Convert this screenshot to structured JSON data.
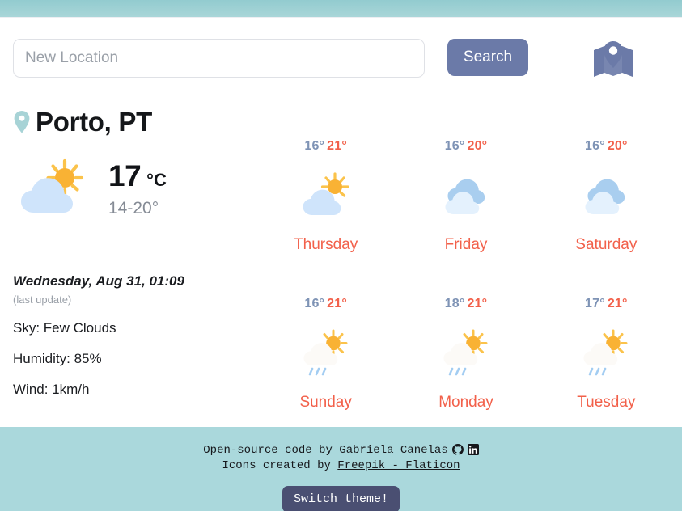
{
  "theme": {
    "teal_bar": "#a9d6d8",
    "footer_bg": "#aad8dc",
    "accent_button": "#6b7aa8",
    "theme_button": "#4a4f72",
    "max_temp_color": "#f2604a",
    "min_temp_color": "#7e93b5",
    "pin_color": "#a7d3d6"
  },
  "search": {
    "placeholder": "New Location",
    "value": "",
    "button_label": "Search",
    "map_icon": "map-pin-icon"
  },
  "current": {
    "location_pin_icon": "location-pin-icon",
    "city": "Porto, PT",
    "icon": "sun-behind-cloud-icon",
    "temperature": "17",
    "unit": "°C",
    "range": "14-20°"
  },
  "details": {
    "last_update_date": "Wednesday, Aug 31, 01:09",
    "last_update_note": "(last update)",
    "lines": [
      "Sky: Few Clouds",
      "Humidity: 85%",
      "Wind: 1km/h"
    ]
  },
  "forecast": [
    {
      "min": "16°",
      "max": "21°",
      "day": "Thursday",
      "icon": "sun-behind-cloud-icon"
    },
    {
      "min": "16°",
      "max": "20°",
      "day": "Friday",
      "icon": "cloudy-icon"
    },
    {
      "min": "16°",
      "max": "20°",
      "day": "Saturday",
      "icon": "cloudy-icon"
    },
    {
      "min": "16°",
      "max": "21°",
      "day": "Sunday",
      "icon": "sun-behind-rain-cloud-icon"
    },
    {
      "min": "18°",
      "max": "21°",
      "day": "Monday",
      "icon": "sun-behind-rain-cloud-icon"
    },
    {
      "min": "17°",
      "max": "21°",
      "day": "Tuesday",
      "icon": "sun-behind-rain-cloud-icon"
    }
  ],
  "footer": {
    "credit_text": "Open-source code by Gabriela Canelas",
    "github_icon": "github-icon",
    "linkedin_icon": "linkedin-icon",
    "icons_text": "Icons created by ",
    "icons_link": "Freepik - Flaticon",
    "theme_button_label": "Switch theme!"
  }
}
